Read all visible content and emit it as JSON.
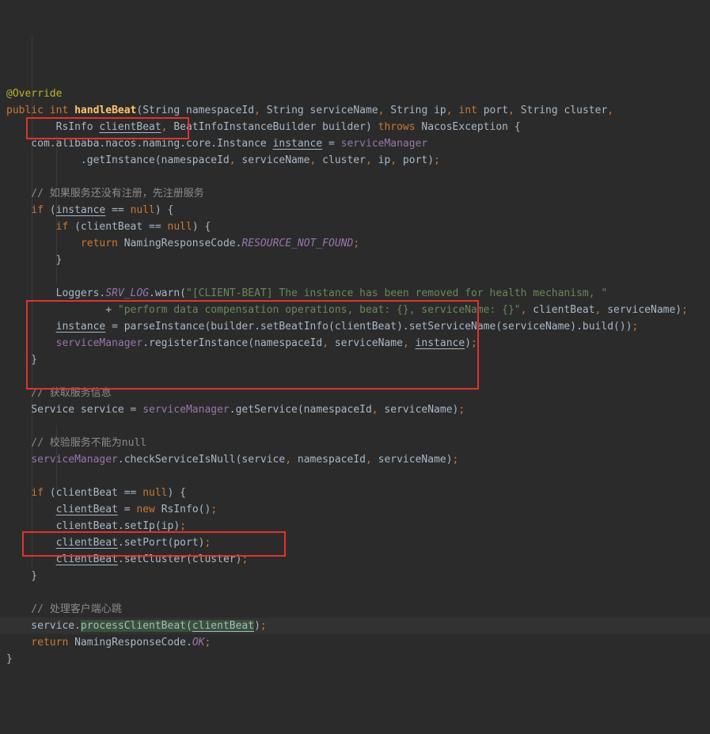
{
  "editor": {
    "language": "java",
    "active_line": 33,
    "highlight_colors": {
      "background": "#2b2b2b",
      "active_line": "#323232",
      "keyword": "#cc7832",
      "annotation": "#bbb529",
      "method_declaration": "#ffc66b",
      "string": "#6a8759",
      "comment": "#8c8c8c",
      "field": "#9876aa",
      "constant": "#9876aa",
      "punctuation": "#cc7832",
      "occurrence_highlight": "#375239",
      "annotation_box_red": "#df332e"
    },
    "lines": [
      {
        "segments": [
          [
            "ann",
            "@Override"
          ]
        ]
      },
      {
        "segments": [
          [
            "kw",
            "public"
          ],
          [
            "t",
            " "
          ],
          [
            "kw",
            "int"
          ],
          [
            "t",
            " "
          ],
          [
            "decl",
            "handleBeat"
          ],
          [
            "t",
            "(String namespaceId"
          ],
          [
            "pn",
            ","
          ],
          [
            "t",
            " String serviceName"
          ],
          [
            "pn",
            ","
          ],
          [
            "t",
            " String ip"
          ],
          [
            "pn",
            ","
          ],
          [
            "t",
            " "
          ],
          [
            "kw",
            "int"
          ],
          [
            "t",
            " port"
          ],
          [
            "pn",
            ","
          ],
          [
            "t",
            " String cluster"
          ],
          [
            "pn",
            ","
          ]
        ]
      },
      {
        "segments": [
          [
            "t",
            "        RsInfo "
          ],
          [
            "u",
            "clientBeat"
          ],
          [
            "pn",
            ","
          ],
          [
            "t",
            " BeatInfoInstanceBuilder builder) "
          ],
          [
            "kw",
            "throws"
          ],
          [
            "t",
            " NacosException {"
          ]
        ]
      },
      {
        "segments": [
          [
            "t",
            "    com.alibaba.nacos.naming.core.Instance "
          ],
          [
            "u",
            "instance"
          ],
          [
            "t",
            " = "
          ],
          [
            "fld",
            "serviceManager"
          ]
        ]
      },
      {
        "segments": [
          [
            "t",
            "            .getInstance(namespaceId"
          ],
          [
            "pn",
            ","
          ],
          [
            "t",
            " serviceName"
          ],
          [
            "pn",
            ","
          ],
          [
            "t",
            " cluster"
          ],
          [
            "pn",
            ","
          ],
          [
            "t",
            " ip"
          ],
          [
            "pn",
            ","
          ],
          [
            "t",
            " port)"
          ],
          [
            "pn",
            ";"
          ]
        ]
      },
      {
        "segments": []
      },
      {
        "segments": [
          [
            "cmt",
            "    // 如果服务还没有注册，先注册服务"
          ]
        ]
      },
      {
        "segments": [
          [
            "t",
            "    "
          ],
          [
            "kw",
            "if"
          ],
          [
            "t",
            " ("
          ],
          [
            "u",
            "instance"
          ],
          [
            "t",
            " == "
          ],
          [
            "kw",
            "null"
          ],
          [
            "t",
            ") {"
          ]
        ]
      },
      {
        "segments": [
          [
            "t",
            "        "
          ],
          [
            "kw",
            "if"
          ],
          [
            "t",
            " (clientBeat == "
          ],
          [
            "kw",
            "null"
          ],
          [
            "t",
            ") {"
          ]
        ]
      },
      {
        "segments": [
          [
            "t",
            "            "
          ],
          [
            "kw",
            "return"
          ],
          [
            "t",
            " NamingResponseCode."
          ],
          [
            "cst",
            "RESOURCE_NOT_FOUND"
          ],
          [
            "pn",
            ";"
          ]
        ]
      },
      {
        "segments": [
          [
            "t",
            "        }"
          ]
        ]
      },
      {
        "segments": []
      },
      {
        "segments": [
          [
            "t",
            "        Loggers."
          ],
          [
            "cst",
            "SRV_LOG"
          ],
          [
            "t",
            ".warn("
          ],
          [
            "str",
            "\"[CLIENT-BEAT] The instance has been removed for health mechanism, \""
          ]
        ]
      },
      {
        "segments": [
          [
            "t",
            "                + "
          ],
          [
            "str",
            "\"perform data compensation operations, beat: {}, serviceName: {}\""
          ],
          [
            "pn",
            ","
          ],
          [
            "t",
            " clientBeat"
          ],
          [
            "pn",
            ","
          ],
          [
            "t",
            " serviceName)"
          ],
          [
            "pn",
            ";"
          ]
        ]
      },
      {
        "segments": [
          [
            "t",
            "        "
          ],
          [
            "u",
            "instance"
          ],
          [
            "t",
            " = parseInstance(builder.setBeatInfo(clientBeat).setServiceName(serviceName).build())"
          ],
          [
            "pn",
            ";"
          ]
        ]
      },
      {
        "segments": [
          [
            "t",
            "        "
          ],
          [
            "fld",
            "serviceManager"
          ],
          [
            "t",
            ".registerInstance(namespaceId"
          ],
          [
            "pn",
            ","
          ],
          [
            "t",
            " serviceName"
          ],
          [
            "pn",
            ","
          ],
          [
            "t",
            " "
          ],
          [
            "u",
            "instance"
          ],
          [
            "t",
            ")"
          ],
          [
            "pn",
            ";"
          ]
        ]
      },
      {
        "segments": [
          [
            "t",
            "    }"
          ]
        ]
      },
      {
        "segments": []
      },
      {
        "segments": [
          [
            "cmt",
            "    // 获取服务信息"
          ]
        ]
      },
      {
        "segments": [
          [
            "t",
            "    Service service = "
          ],
          [
            "fld",
            "serviceManager"
          ],
          [
            "t",
            ".getService(namespaceId"
          ],
          [
            "pn",
            ","
          ],
          [
            "t",
            " serviceName)"
          ],
          [
            "pn",
            ";"
          ]
        ]
      },
      {
        "segments": []
      },
      {
        "segments": [
          [
            "cmt",
            "    // 校验服务不能为null"
          ]
        ]
      },
      {
        "segments": [
          [
            "t",
            "    "
          ],
          [
            "fld",
            "serviceManager"
          ],
          [
            "t",
            ".checkServiceIsNull(service"
          ],
          [
            "pn",
            ","
          ],
          [
            "t",
            " namespaceId"
          ],
          [
            "pn",
            ","
          ],
          [
            "t",
            " serviceName)"
          ],
          [
            "pn",
            ";"
          ]
        ]
      },
      {
        "segments": []
      },
      {
        "segments": [
          [
            "t",
            "    "
          ],
          [
            "kw",
            "if"
          ],
          [
            "t",
            " (clientBeat == "
          ],
          [
            "kw",
            "null"
          ],
          [
            "t",
            ") {"
          ]
        ]
      },
      {
        "segments": [
          [
            "t",
            "        "
          ],
          [
            "u",
            "clientBeat"
          ],
          [
            "t",
            " = "
          ],
          [
            "kw",
            "new"
          ],
          [
            "t",
            " RsInfo()"
          ],
          [
            "pn",
            ";"
          ]
        ]
      },
      {
        "segments": [
          [
            "t",
            "        "
          ],
          [
            "u",
            "clientBeat"
          ],
          [
            "t",
            ".setIp(ip)"
          ],
          [
            "pn",
            ";"
          ]
        ]
      },
      {
        "segments": [
          [
            "t",
            "        "
          ],
          [
            "u",
            "clientBeat"
          ],
          [
            "t",
            ".setPort(port)"
          ],
          [
            "pn",
            ";"
          ]
        ]
      },
      {
        "segments": [
          [
            "t",
            "        "
          ],
          [
            "u",
            "clientBeat"
          ],
          [
            "t",
            ".setCluster(cluster)"
          ],
          [
            "pn",
            ";"
          ]
        ]
      },
      {
        "segments": [
          [
            "t",
            "    }"
          ]
        ]
      },
      {
        "segments": []
      },
      {
        "segments": [
          [
            "cmt",
            "    // 处理客户端心跳"
          ]
        ]
      },
      {
        "segments": [
          [
            "t",
            "    service."
          ],
          [
            "hl",
            "processClientBeat("
          ],
          [
            "hlu",
            "clientBeat"
          ],
          [
            "t",
            ")"
          ],
          [
            "pn",
            ";"
          ]
        ]
      },
      {
        "segments": [
          [
            "t",
            "    "
          ],
          [
            "kw",
            "return"
          ],
          [
            "t",
            " NamingResponseCode."
          ],
          [
            "cst",
            "OK"
          ],
          [
            "pn",
            ";"
          ]
        ]
      },
      {
        "segments": [
          [
            "t",
            "}"
          ]
        ]
      }
    ]
  }
}
